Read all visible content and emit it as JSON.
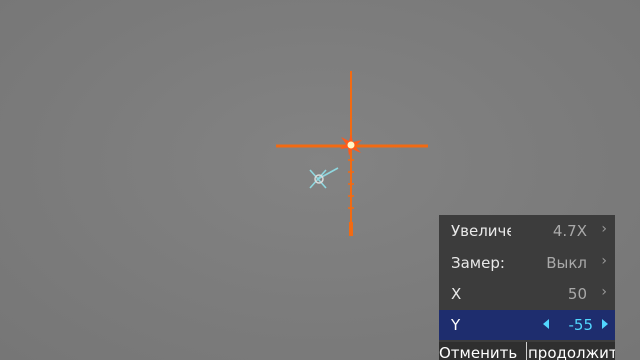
{
  "menu": {
    "rows": [
      {
        "label": "Увеличение",
        "value": "4.7X"
      },
      {
        "label": "Замер:",
        "value": "Выкл"
      },
      {
        "label": "X",
        "value": "50"
      },
      {
        "label": "Y",
        "value": "-55"
      }
    ],
    "buttons": {
      "cancel": "Отменить",
      "continue": "продолжить"
    }
  },
  "colors": {
    "reticle": "#f26a12",
    "highlight": "#1e2d6e",
    "value_active": "#52d7ff",
    "marker": "#8fd8e0"
  },
  "icons": {
    "chevron": "›",
    "impact": "impact-burst-icon",
    "target": "target-marker-icon"
  }
}
